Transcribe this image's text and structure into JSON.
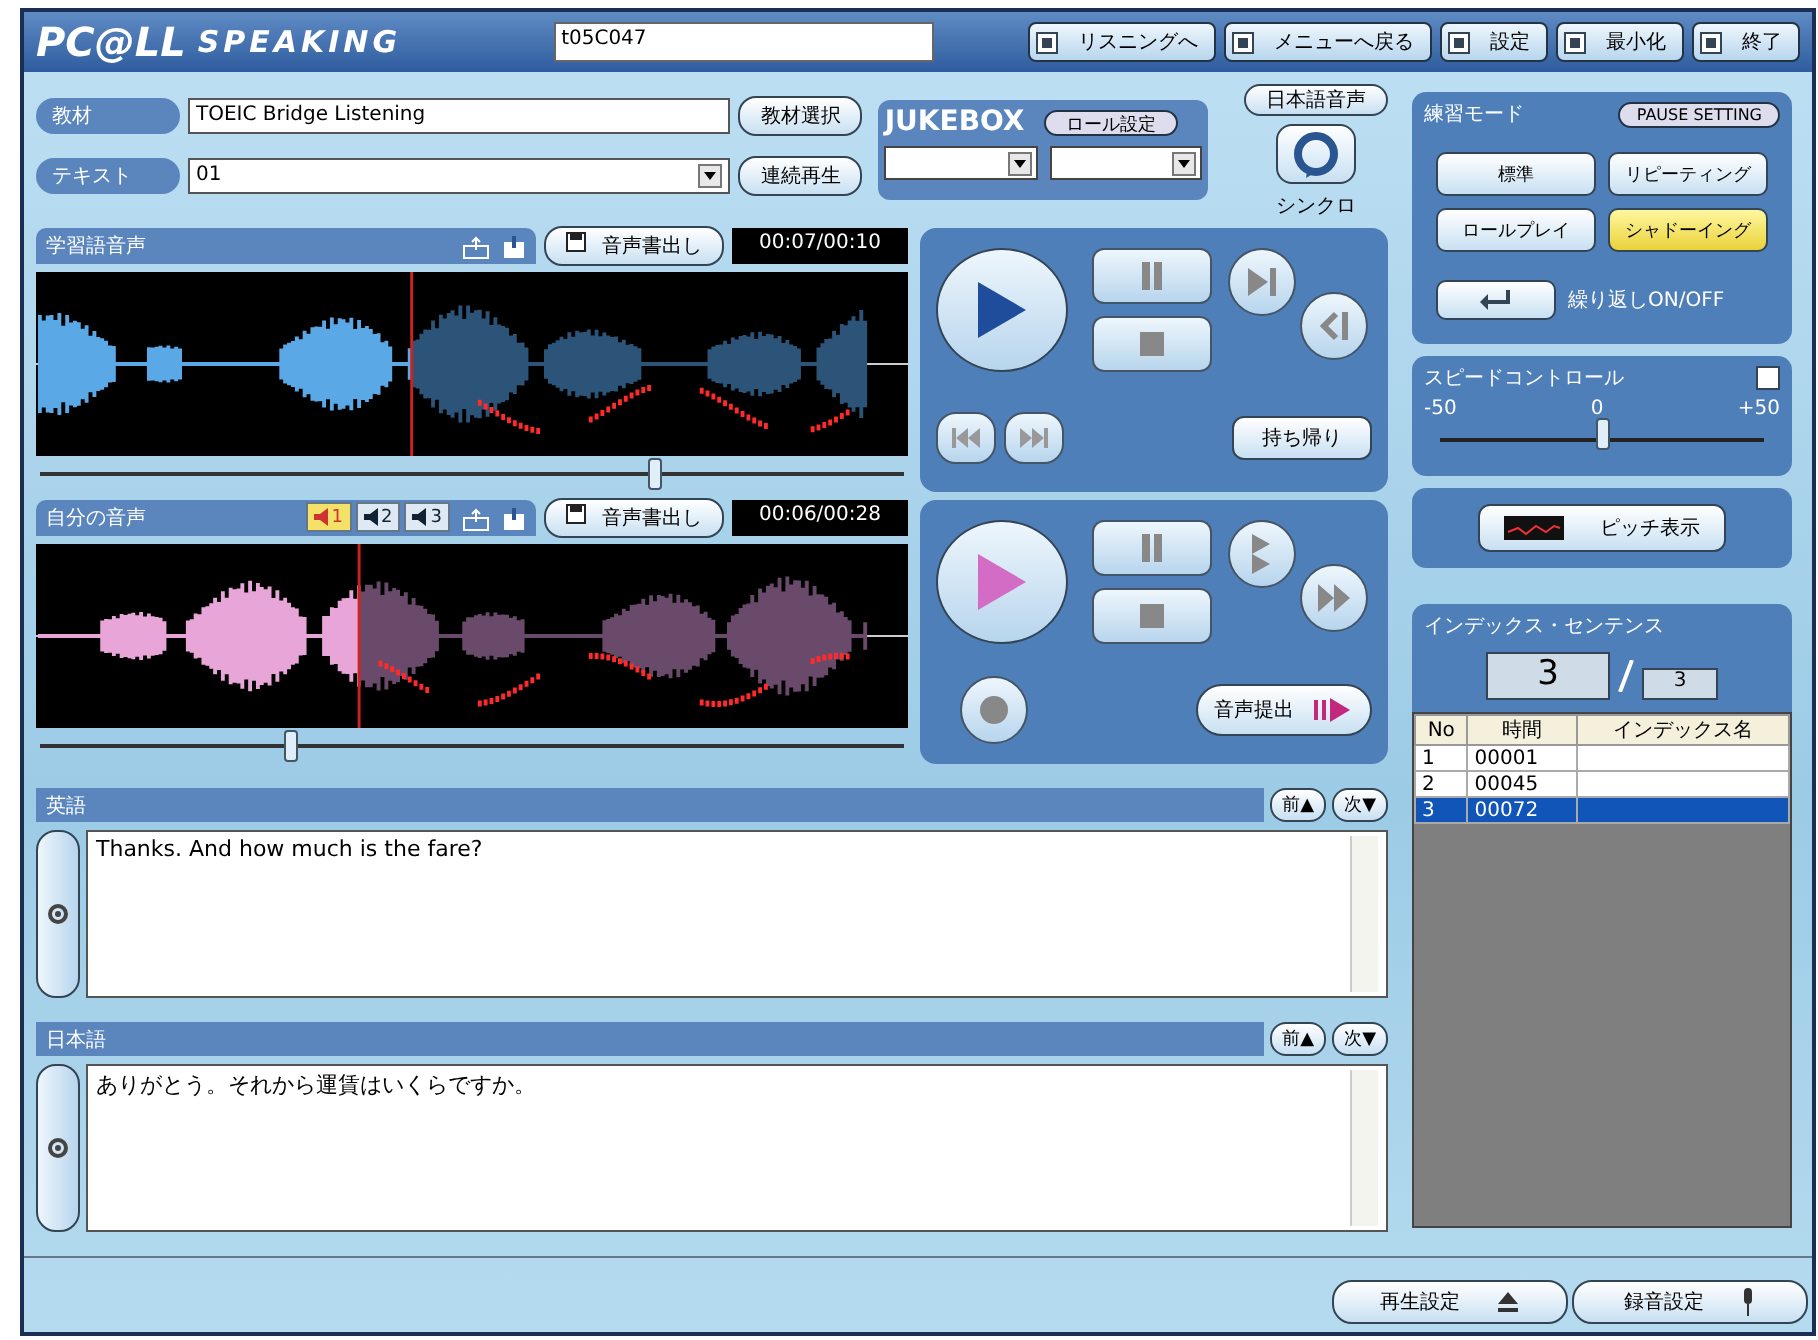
{
  "title_bar": {
    "logo": "PC@LL",
    "product": "SPEAKING",
    "user_id": "t05C047",
    "buttons": [
      {
        "label": "リスニングへ"
      },
      {
        "label": "メニューへ戻る"
      },
      {
        "label": "設定"
      },
      {
        "label": "最小化"
      },
      {
        "label": "終了"
      }
    ]
  },
  "material": {
    "label": "教材",
    "value": "TOEIC Bridge Listening",
    "button": "教材選択"
  },
  "text_select": {
    "label": "テキスト",
    "value": "01",
    "button": "連続再生"
  },
  "jukebox": {
    "title": "JUKEBOX",
    "button": "ロール設定"
  },
  "japanese_audio_button": "日本語音声",
  "sync_label": "シンクロ",
  "model_audio": {
    "title": "学習語音声",
    "export_button": "音声書出し",
    "time": "00:07/00:10",
    "level": 0.71,
    "cut_button": "持ち帰り"
  },
  "my_audio": {
    "title": "自分の音声",
    "tabs": [
      {
        "label": "1",
        "selected": true
      },
      {
        "label": "2",
        "selected": false
      },
      {
        "label": "3",
        "selected": false
      }
    ],
    "export_button": "音声書出し",
    "time": "00:06/00:28",
    "level": 0.29,
    "submit_button": "音声提出"
  },
  "english": {
    "title": "英語",
    "prev_button": "前▲",
    "next_button": "次▼",
    "text": "Thanks. And how much is the fare?"
  },
  "japanese": {
    "title": "日本語",
    "prev_button": "前▲",
    "next_button": "次▼",
    "text": "ありがとう。それから運賃はいくらですか。"
  },
  "practice_mode": {
    "title": "練習モード",
    "pause_button": "PAUSE SETTING",
    "modes": [
      {
        "label": "標準",
        "selected": false
      },
      {
        "label": "リピーティング",
        "selected": false
      },
      {
        "label": "ロールプレイ",
        "selected": false
      },
      {
        "label": "シャドーイング",
        "selected": true
      }
    ],
    "repeat_label": "繰り返しON/OFF"
  },
  "speed_control": {
    "title": "スピードコントロール",
    "checked": false,
    "min": "-50",
    "mid": "0",
    "max": "+50",
    "level": 0.5
  },
  "pitch_button": "ピッチ表示",
  "index": {
    "title": "インデックス・センテンス",
    "current": "3",
    "total": "3",
    "columns": [
      "No",
      "時間",
      "インデックス名"
    ],
    "rows": [
      {
        "no": "1",
        "time": "00001",
        "selected": false
      },
      {
        "no": "2",
        "time": "00045",
        "selected": false
      },
      {
        "no": "3",
        "time": "00072",
        "selected": true
      }
    ]
  },
  "bottom_buttons": [
    "再生設定",
    "録音設定"
  ]
}
